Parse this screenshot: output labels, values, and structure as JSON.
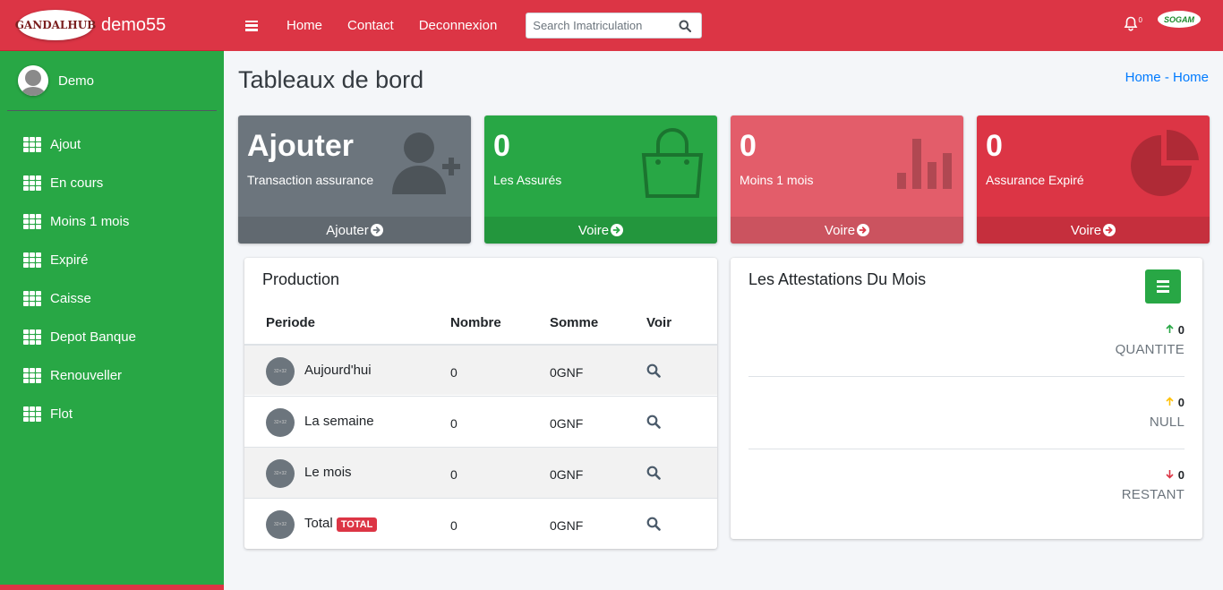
{
  "brand": {
    "logo_text": "GANDALHUB",
    "name": "demo55"
  },
  "user": {
    "name": "Demo"
  },
  "sidebar": {
    "items": [
      {
        "label": "Ajout"
      },
      {
        "label": "En cours"
      },
      {
        "label": "Moins 1 mois"
      },
      {
        "label": "Expiré"
      },
      {
        "label": "Caisse"
      },
      {
        "label": "Depot Banque"
      },
      {
        "label": "Renouveller"
      },
      {
        "label": "Flot"
      }
    ]
  },
  "topbar": {
    "links": [
      "Home",
      "Contact",
      "Deconnexion"
    ],
    "search_placeholder": "Search Imatriculation",
    "notification_count": "0",
    "partner_logo_text": "SOGAM"
  },
  "page": {
    "title": "Tableaux de bord",
    "breadcrumb": [
      "Home",
      "Home"
    ]
  },
  "info_boxes": [
    {
      "big": "Ajouter",
      "sub": "Transaction assurance",
      "footer": "Ajouter",
      "color": "#6c757d",
      "icon": "user-plus-icon"
    },
    {
      "big": "0",
      "sub": "Les Assurés",
      "footer": "Voire",
      "color": "#28a745",
      "icon": "shopping-bag-icon"
    },
    {
      "big": "0",
      "sub": "Moins 1 mois",
      "footer": "Voire",
      "color": "#dc3545",
      "icon": "bar-chart-icon"
    },
    {
      "big": "0",
      "sub": "Assurance Expiré",
      "footer": "Voire",
      "color": "#dc3545",
      "icon": "pie-chart-icon"
    }
  ],
  "production": {
    "title": "Production",
    "columns": [
      "Periode",
      "Nombre",
      "Somme",
      "Voir"
    ],
    "rows": [
      {
        "period": "Aujourd'hui",
        "nombre": "0",
        "somme": "0GNF"
      },
      {
        "period": "La semaine",
        "nombre": "0",
        "somme": "0GNF"
      },
      {
        "period": "Le mois",
        "nombre": "0",
        "somme": "0GNF"
      },
      {
        "period": "Total",
        "nombre": "0",
        "somme": "0GNF",
        "badge": "TOTAL"
      }
    ],
    "icon_placeholder": "32×32"
  },
  "attestations": {
    "title": "Les Attestations Du Mois",
    "stats": [
      {
        "value": "0",
        "label": "QUANTITE",
        "arrow_color": "#28a745",
        "direction": "up"
      },
      {
        "value": "0",
        "label": "NULL",
        "arrow_color": "#ffc107",
        "direction": "up"
      },
      {
        "value": "0",
        "label": "RESTANT",
        "arrow_color": "#dc3545",
        "direction": "down"
      }
    ]
  }
}
